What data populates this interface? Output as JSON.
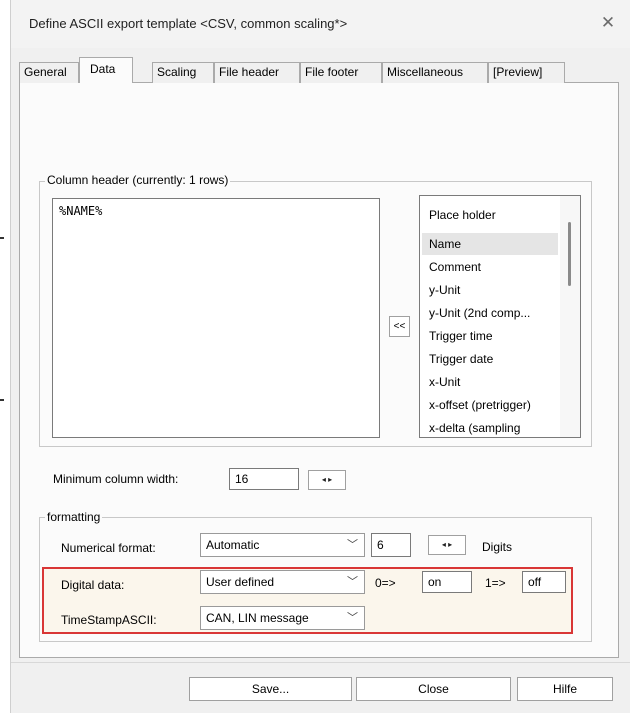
{
  "window": {
    "title": "Define ASCII export template <CSV, common scaling*>",
    "close_symbol": "✕"
  },
  "tabs": [
    {
      "label": "General"
    },
    {
      "label": "Data",
      "active": true
    },
    {
      "label": "Scaling"
    },
    {
      "label": "File header"
    },
    {
      "label": "File footer"
    },
    {
      "label": "Miscellaneous"
    },
    {
      "label": "[Preview]"
    }
  ],
  "column_header": {
    "legend": "Column header (currently: 1 rows)",
    "text": "%NAME%",
    "insert_button": "<<",
    "placeholder_list": {
      "header": "Place holder",
      "items": [
        "Name",
        "Comment",
        "y-Unit",
        "y-Unit (2nd comp...",
        "Trigger time",
        "Trigger date",
        "x-Unit",
        "x-offset (pretrigger)",
        "x-delta (sampling"
      ],
      "selected": "Name"
    }
  },
  "min_column_width": {
    "label": "Minimum column width:",
    "value": "16"
  },
  "formatting": {
    "legend": "formatting",
    "numerical_format_label": "Numerical format:",
    "numerical_format_value": "Automatic",
    "digits_value": "6",
    "digits_label": "Digits",
    "digital_data_label": "Digital data:",
    "digital_data_value": "User defined",
    "zero_label": "0=>",
    "zero_value": "on",
    "one_label": "1=>",
    "one_value": "off",
    "timestamp_label": "TimeStampASCII:",
    "timestamp_value": "CAN, LIN message"
  },
  "buttons": {
    "save": "Save...",
    "close": "Close",
    "help": "Hilfe"
  },
  "colors": {
    "highlight_border": "#d93636",
    "selected_item": "#e5e5e5"
  }
}
